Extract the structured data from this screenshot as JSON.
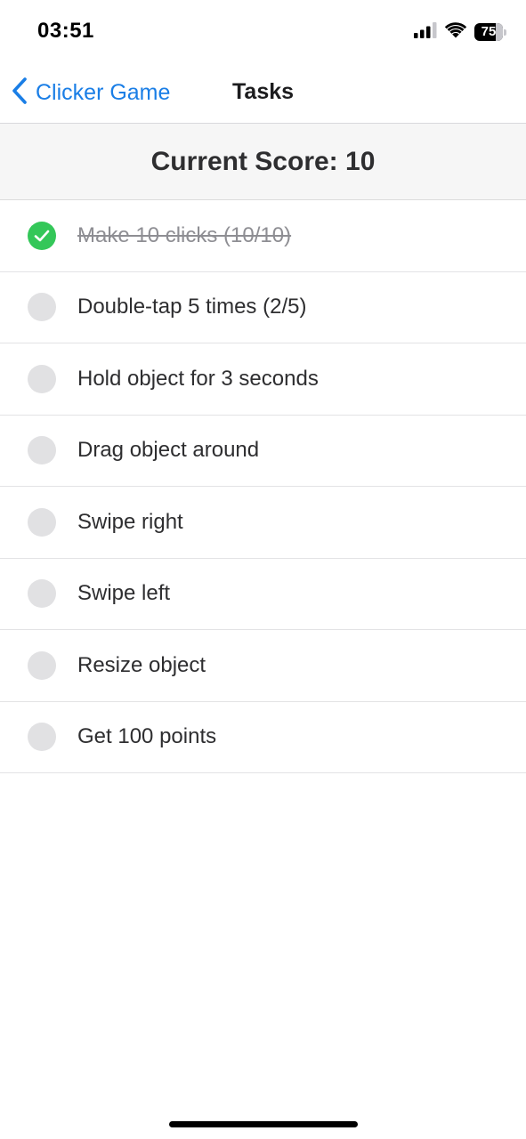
{
  "status_bar": {
    "time": "03:51",
    "battery_level": "75",
    "icons": [
      "cellular-signal-icon",
      "wifi-icon",
      "battery-icon"
    ]
  },
  "nav": {
    "back_label": "Clicker Game",
    "back_icon": "chevron-left-icon",
    "title": "Tasks"
  },
  "score": {
    "text": "Current Score: 10"
  },
  "tasks": [
    {
      "label": "Make 10 clicks (10/10)",
      "done": true
    },
    {
      "label": "Double-tap 5 times (2/5)",
      "done": false
    },
    {
      "label": "Hold object for 3 seconds",
      "done": false
    },
    {
      "label": "Drag object around",
      "done": false
    },
    {
      "label": "Swipe right",
      "done": false
    },
    {
      "label": "Swipe left",
      "done": false
    },
    {
      "label": "Resize object",
      "done": false
    },
    {
      "label": "Get 100 points",
      "done": false
    }
  ],
  "colors": {
    "accent": "#1a7ee6",
    "done": "#34c759",
    "pending": "#e1e1e3"
  }
}
